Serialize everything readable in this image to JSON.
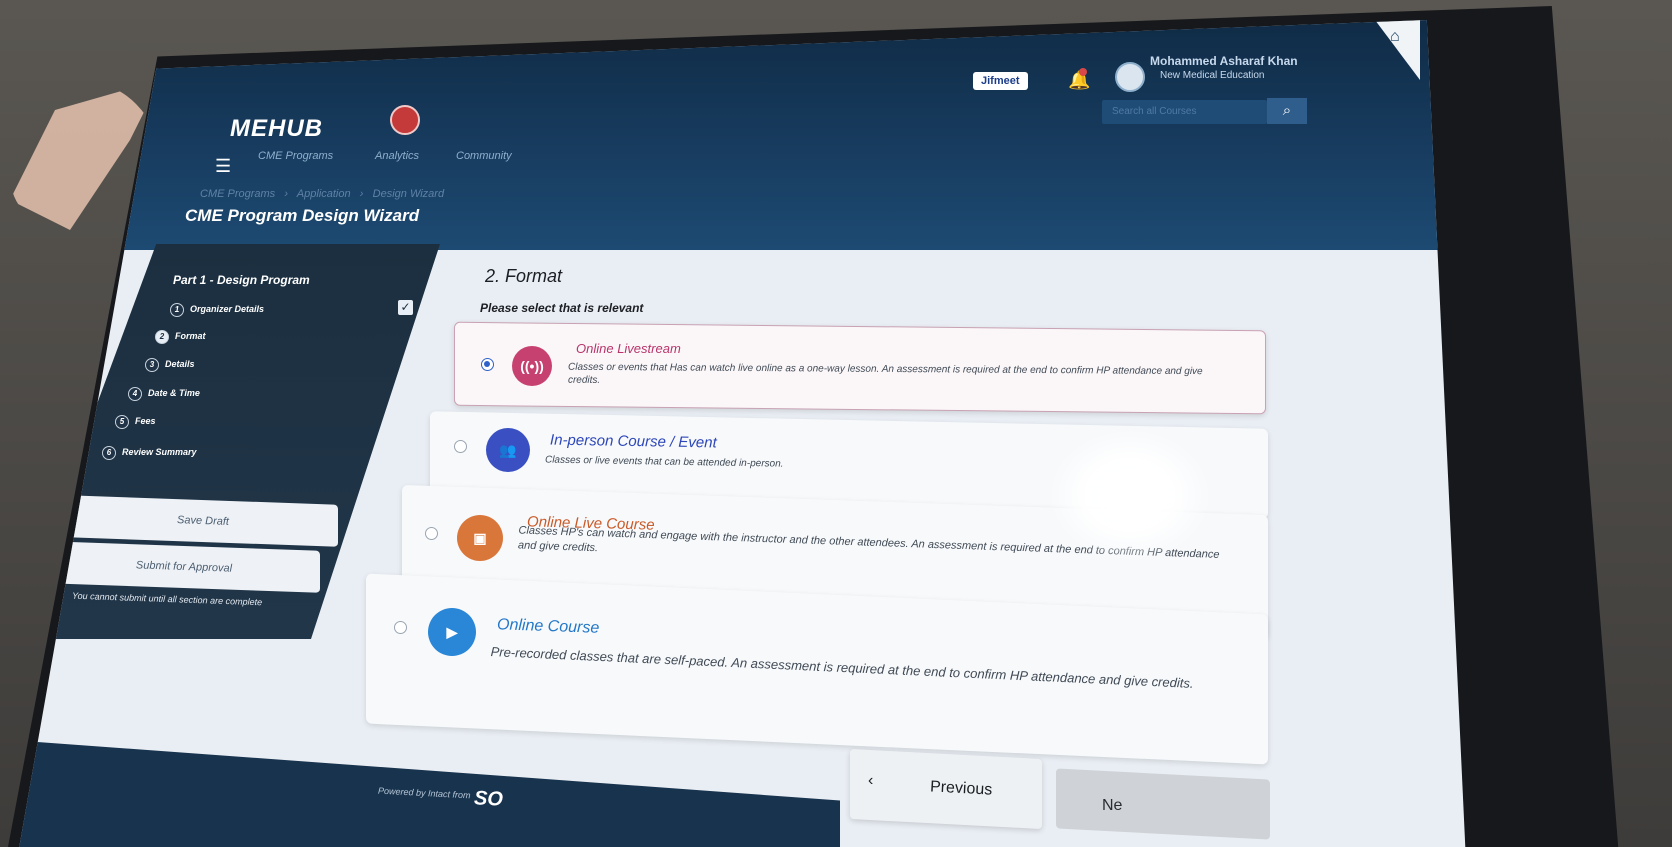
{
  "header": {
    "logo_text": "MEHUB",
    "nav": [
      "CME Programs",
      "Analytics",
      "Community"
    ],
    "jifmeet_label": "Jifmeet",
    "user_name": "Mohammed Asharaf Khan",
    "user_role": "New Medical Education",
    "search_placeholder": "Search all Courses"
  },
  "breadcrumb": [
    "CME Programs",
    "Application",
    "Design Wizard"
  ],
  "page_title": "CME Program Design Wizard",
  "sidebar": {
    "section_title": "Part 1 - Design Program",
    "steps": [
      {
        "num": "1",
        "label": "Organizer Details",
        "complete": true
      },
      {
        "num": "2",
        "label": "Format",
        "active": true
      },
      {
        "num": "3",
        "label": "Details"
      },
      {
        "num": "4",
        "label": "Date & Time"
      },
      {
        "num": "5",
        "label": "Fees"
      },
      {
        "num": "6",
        "label": "Review Summary"
      }
    ],
    "save_draft_label": "Save Draft",
    "submit_label": "Submit for Approval",
    "note": "You cannot submit until all section are complete"
  },
  "format": {
    "title": "2. Format",
    "subtitle": "Please select that is relevant",
    "options": [
      {
        "title": "Online Livestream",
        "description": "Classes or events that Has can watch live online as a one-way lesson. An assessment is required at the end to confirm HP attendance and give credits.",
        "selected": true,
        "icon": "livestream-icon",
        "color": "#c6416f"
      },
      {
        "title": "In-person Course / Event",
        "description": "Classes or live events that can be attended in-person.",
        "selected": false,
        "icon": "people-icon",
        "color": "#3a4fc2"
      },
      {
        "title": "Online Live Course",
        "description": "Classes HP's can watch and engage with the instructor and the other attendees. An assessment is required at the end to confirm HP attendance and give credits.",
        "selected": false,
        "icon": "presentation-icon",
        "color": "#d9773b"
      },
      {
        "title": "Online Course",
        "description": "Pre-recorded classes that are self-paced. An assessment is required at the end to confirm HP attendance and give credits.",
        "selected": false,
        "icon": "play-icon",
        "color": "#2a86d6"
      }
    ]
  },
  "footer": {
    "previous_label": "Previous",
    "next_label": "Ne",
    "powered_by": "Powered by Intact from",
    "brand": "SO"
  },
  "colors": {
    "header_dark": "#0f2a44",
    "panel_dark": "#1b2f40",
    "selected_radio": "#2f62c9"
  }
}
